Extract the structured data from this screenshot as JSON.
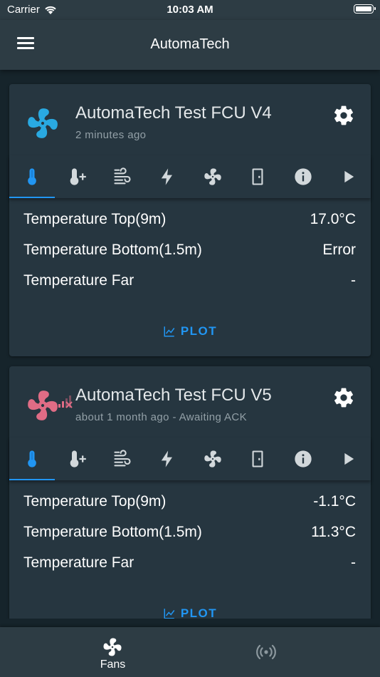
{
  "status_bar": {
    "carrier": "Carrier",
    "time": "10:03 AM"
  },
  "app_bar": {
    "title": "AutomaTech",
    "menu_icon": "hamburger-menu-icon"
  },
  "colors": {
    "accent": "#2196f3",
    "fan_online": "#29a9e1",
    "fan_offline": "#e06c85",
    "background": "#16242b",
    "card": "#263640",
    "bar": "#2d3c44"
  },
  "tab_icons": [
    "thermometer-icon",
    "thermometer-plus-icon",
    "wind-icon",
    "lightning-icon",
    "fan-icon",
    "door-icon",
    "info-icon",
    "play-icon"
  ],
  "devices": [
    {
      "name": "AutomaTech Test FCU V4",
      "subtitle": "2 minutes ago",
      "status": "online",
      "active_tab": 0,
      "readings": [
        {
          "label": "Temperature Top(9m)",
          "value": "17.0°C"
        },
        {
          "label": "Temperature Bottom(1.5m)",
          "value": "Error"
        },
        {
          "label": "Temperature Far",
          "value": "-"
        }
      ],
      "plot_label": "PLOT"
    },
    {
      "name": "AutomaTech Test FCU V5",
      "subtitle": "about 1 month ago - Awaiting ACK",
      "status": "offline",
      "active_tab": 0,
      "readings": [
        {
          "label": "Temperature Top(9m)",
          "value": "-1.1°C"
        },
        {
          "label": "Temperature Bottom(1.5m)",
          "value": "11.3°C"
        },
        {
          "label": "Temperature Far",
          "value": "-"
        }
      ],
      "plot_label": "PLOT"
    }
  ],
  "bottom_nav": {
    "items": [
      {
        "label": "Fans",
        "icon": "fan-icon",
        "active": true
      },
      {
        "label": "",
        "icon": "broadcast-icon",
        "active": false
      }
    ]
  }
}
